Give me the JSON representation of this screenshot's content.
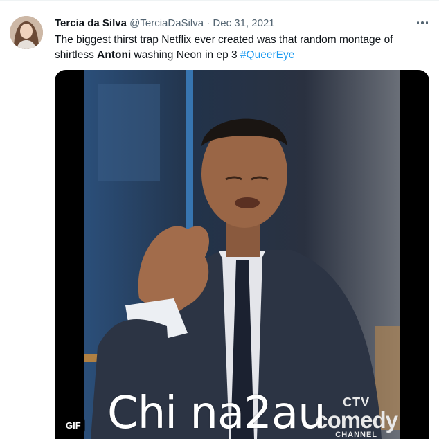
{
  "tweet": {
    "display_name": "Tercia da Silva",
    "handle": "@TerciaDaSilva",
    "separator": "·",
    "date": "Dec 31, 2021",
    "text_part1": "The biggest thirst trap Netflix ever created was that random montage of shirtless ",
    "text_bold": "Antoni",
    "text_part2": " washing Neon in ep 3 ",
    "hashtag": "#QueerEye",
    "media": {
      "badge": "GIF",
      "logo_top": "CTV",
      "logo_main": "comedy",
      "logo_bottom": "CHANNEL"
    }
  },
  "watermark": "Chi na2au",
  "colors": {
    "accent": "#1d9bf0",
    "muted": "#536471",
    "text": "#0f1419"
  },
  "icons": {
    "more": "more-horizontal-icon"
  }
}
